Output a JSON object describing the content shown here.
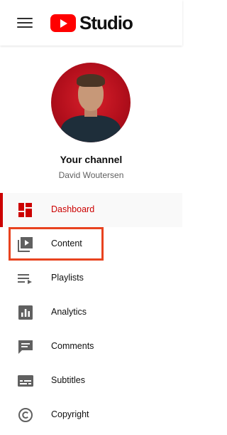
{
  "header": {
    "menu_icon": "hamburger-menu-icon",
    "logo_text": "Studio"
  },
  "channel": {
    "title": "Your channel",
    "owner_name": "David Woutersen"
  },
  "nav": {
    "items": [
      {
        "label": "Dashboard",
        "icon": "dashboard-icon",
        "active": true
      },
      {
        "label": "Content",
        "icon": "content-icon",
        "active": false
      },
      {
        "label": "Playlists",
        "icon": "playlists-icon",
        "active": false
      },
      {
        "label": "Analytics",
        "icon": "analytics-icon",
        "active": false
      },
      {
        "label": "Comments",
        "icon": "comments-icon",
        "active": false
      },
      {
        "label": "Subtitles",
        "icon": "subtitles-icon",
        "active": false
      },
      {
        "label": "Copyright",
        "icon": "copyright-icon",
        "active": false
      }
    ]
  },
  "colors": {
    "brand_red": "#ff0000",
    "active_red": "#cc0000",
    "icon_gray": "#606060",
    "highlight_orange": "#e8431f"
  }
}
